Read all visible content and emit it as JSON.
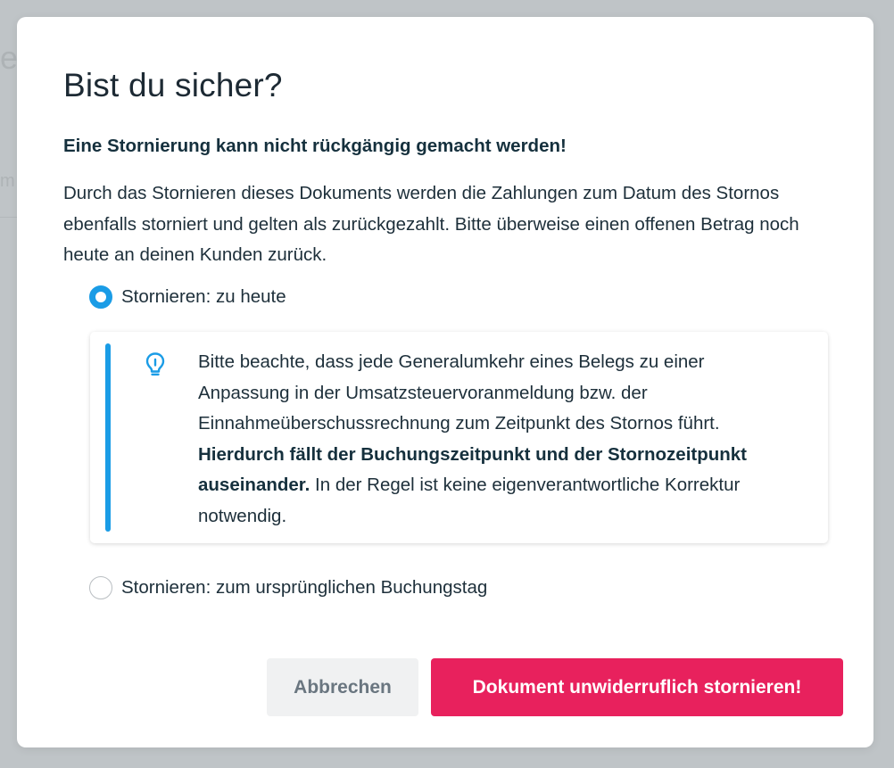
{
  "background": {
    "fragment_a": "e",
    "fragment_b": "m"
  },
  "dialog": {
    "title": "Bist du sicher?",
    "warning": "Eine Stornierung kann nicht rückgängig gemacht werden!",
    "description": "Durch das Stornieren dieses Dokuments werden die Zahlungen zum Datum des Stornos ebenfalls storniert und gelten als zurückgezahlt. Bitte überweise einen offenen Betrag noch heute an deinen Kunden zurück."
  },
  "options": [
    {
      "label": "Stornieren: zu heute",
      "selected": true
    },
    {
      "label": "Stornieren: zum ursprünglichen Buchungstag",
      "selected": false
    }
  ],
  "info": {
    "icon": "lightbulb-icon",
    "text_before": "Bitte beachte, dass jede Generalumkehr eines Belegs zu einer Anpassung in der Umsatzsteuervoranmeldung bzw. der Einnahmeüberschussrechnung zum Zeitpunkt des Stornos führt. ",
    "text_bold": "Hierdurch fällt der Buchungszeitpunkt und der Stornozeitpunkt auseinander.",
    "text_after": " In der Regel ist keine eigenverantwortliche Korrektur notwendig."
  },
  "buttons": {
    "cancel": "Abbrechen",
    "confirm": "Dokument unwiderruflich stornieren!"
  },
  "colors": {
    "accent": "#1a9ce6",
    "danger": "#e8215d",
    "text": "#1d2f3a",
    "cancel_bg": "#f0f1f2"
  }
}
